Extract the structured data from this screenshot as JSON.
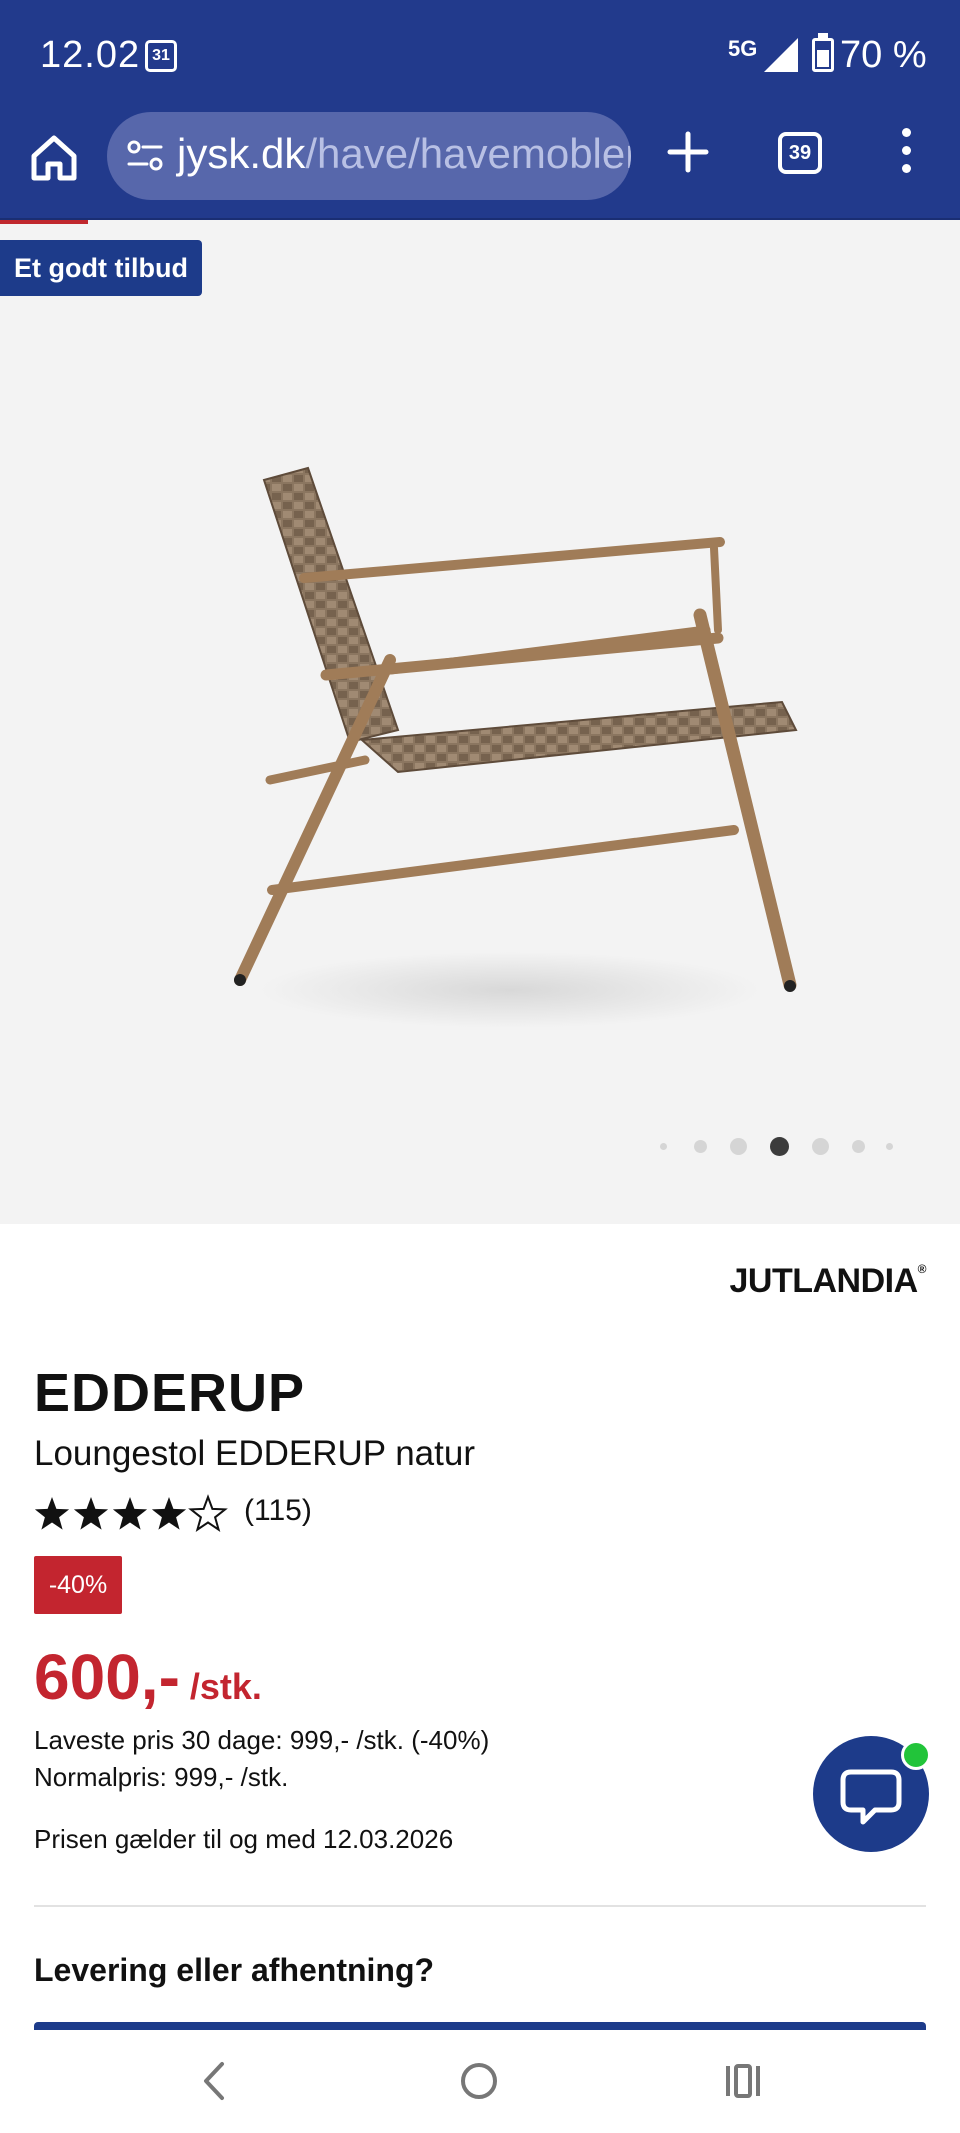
{
  "status_bar": {
    "time": "12.02",
    "calendar_day": "31",
    "network": "5G",
    "battery": "70 %"
  },
  "browser": {
    "url_domain": "jysk.dk",
    "url_path": "/have/havemobler",
    "tab_count": "39",
    "icons": [
      "home-icon",
      "site-settings-icon",
      "plus-icon",
      "tabs-icon",
      "more-vert-icon"
    ]
  },
  "gallery": {
    "promo_label": "Et godt tilbud",
    "image_alt": "Loungestol EDDERUP natur",
    "active_dot": 3,
    "dot_count": 7
  },
  "product": {
    "brand": "JUTLANDIA",
    "brand_mark": "®",
    "name": "EDDERUP",
    "subtitle": "Loungestol EDDERUP natur",
    "rating_value": 4,
    "rating_max": 5,
    "review_count": "(115)",
    "discount_badge": "-40%",
    "price": "600,-",
    "price_unit": "/stk.",
    "lowest_price_line": "Laveste pris 30 dage: 999,- /stk. (-40%)",
    "normal_price_line": "Normalpris: 999,- /stk.",
    "valid_until_line": "Prisen gælder til og med 12.03.2026",
    "delivery_heading": "Levering eller afhentning?"
  },
  "colors": {
    "brand_blue": "#223a8c",
    "sale_red": "#c3252f",
    "online_green": "#22c43a"
  }
}
